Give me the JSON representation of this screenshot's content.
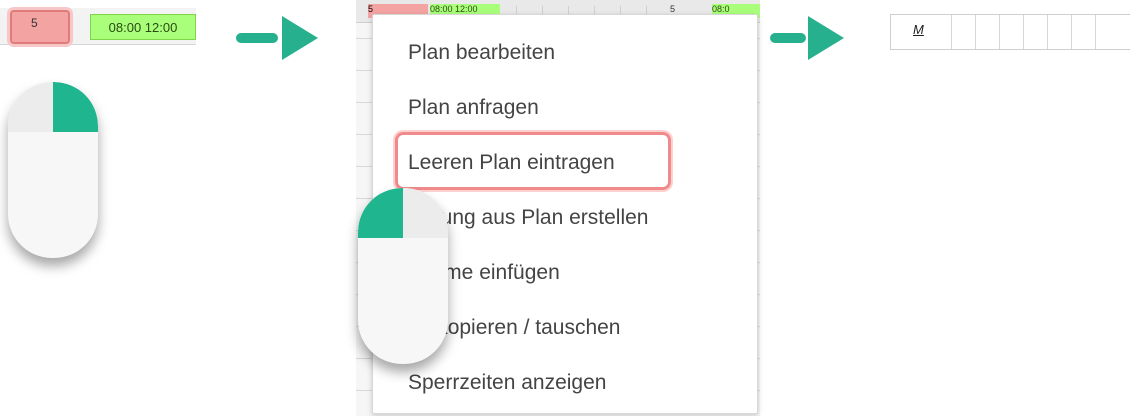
{
  "step1": {
    "cell_value": "5",
    "time_range": "08:00 12:00"
  },
  "step2": {
    "grid_top": {
      "cell1": "5",
      "cell2": "08:00 12:00",
      "cell3": "5",
      "cell4": "08:0"
    },
    "menu_items": [
      "Plan bearbeiten",
      "Plan anfragen",
      "Leeren Plan eintragen",
      "llierung aus Plan erstellen",
      "träume einfügen",
      "ne kopieren / tauschen",
      "Sperrzeiten anzeigen"
    ]
  },
  "step3": {
    "label": "M"
  },
  "colors": {
    "accent": "#26b08e",
    "highlight": "#f08b8b",
    "green_time": "#a9ff7a",
    "red_cell": "#f4a3a3"
  }
}
